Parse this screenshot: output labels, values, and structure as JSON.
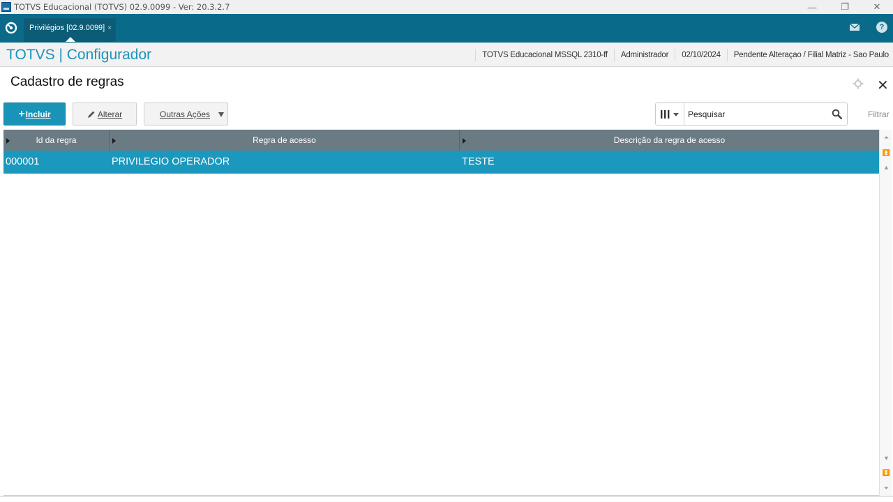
{
  "window": {
    "title": "TOTVS Educacional (TOTVS) 02.9.0099 - Ver: 20.3.2.7",
    "controls": {
      "minimize": "—",
      "restore": "❐",
      "close": "✕"
    }
  },
  "tabbar": {
    "tabs": [
      {
        "label": "Privilégios [02.9.0099]",
        "close": "×"
      }
    ]
  },
  "header": {
    "app_title": "TOTVS | Configurador",
    "info": [
      "TOTVS Educacional MSSQL 2310-ff",
      "Administrador",
      "02/10/2024",
      "Pendente Alteraçao / Filial Matriz - Sao Paulo"
    ]
  },
  "page": {
    "title": "Cadastro de regras"
  },
  "toolbar": {
    "incluir_plus": "+",
    "incluir_label": "Incluir",
    "alterar_label": "Alterar",
    "outras_label": "Outras Ações",
    "search_placeholder": "Pesquisar",
    "filtrar_label": "Filtrar"
  },
  "grid": {
    "columns": [
      "Id da regra",
      "Regra de acesso",
      "Descrição da regra de acesso"
    ],
    "rows": [
      [
        "000001",
        "PRIVILEGIO OPERADOR",
        "TESTE"
      ]
    ]
  },
  "colors": {
    "brand": "#1a93b8",
    "tabbar": "#0a6a8a",
    "grid_header": "#6b7b84",
    "selected_row": "#1b98bd"
  }
}
